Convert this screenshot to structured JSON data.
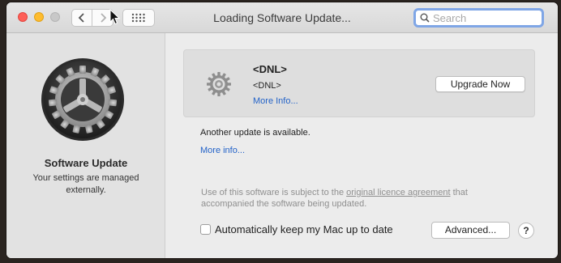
{
  "window": {
    "title": "Loading Software Update..."
  },
  "search": {
    "placeholder": "Search"
  },
  "sidebar": {
    "title": "Software Update",
    "subtitle": "Your settings are managed externally."
  },
  "update": {
    "name": "<DNL>",
    "version": "<DNL>",
    "more_info": "More Info...",
    "upgrade_label": "Upgrade Now",
    "icon": "gear-icon"
  },
  "status": {
    "another_text": "Another update is available.",
    "more_info": "More info..."
  },
  "legal": {
    "prefix": "Use of this software is subject to the ",
    "link": "original licence agreement",
    "suffix": " that accompanied the software being updated."
  },
  "footer": {
    "auto_label": "Automatically keep my Mac up to date",
    "auto_checked": false,
    "advanced_label": "Advanced...",
    "help_label": "?"
  },
  "colors": {
    "accent_link": "#2463c8",
    "close": "#fe5f57",
    "minimize": "#febc2e",
    "search_focus": "#7fa6e6"
  }
}
